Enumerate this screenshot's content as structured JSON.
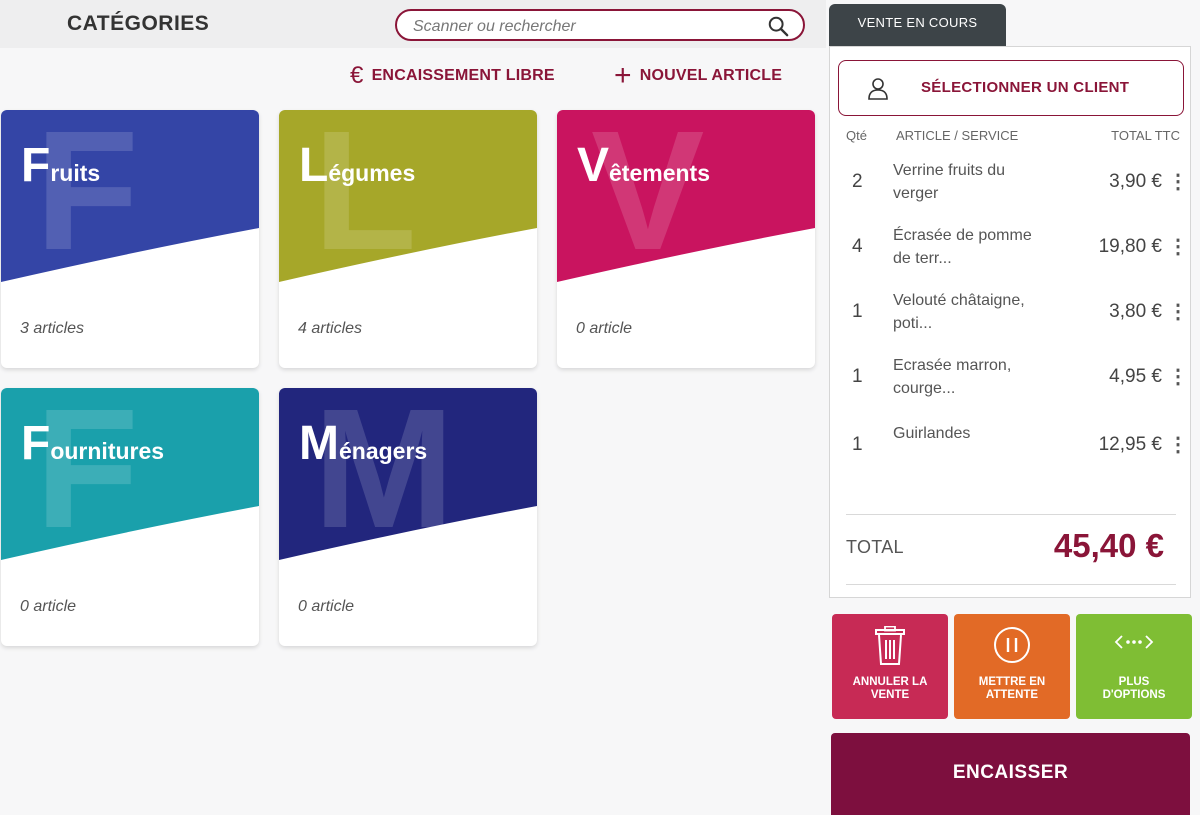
{
  "header": {
    "title": "CATÉGORIES",
    "search_placeholder": "Scanner ou rechercher"
  },
  "actions": {
    "free_checkout": "ENCAISSEMENT LIBRE",
    "free_checkout_glyph": "€",
    "new_item": "NOUVEL ARTICLE",
    "new_item_glyph": "+"
  },
  "categories": [
    {
      "initial": "F",
      "rest": "ruits",
      "count": "3 articles",
      "color": "#3445a6"
    },
    {
      "initial": "L",
      "rest": "égumes",
      "count": "4 articles",
      "color": "#a6a729"
    },
    {
      "initial": "V",
      "rest": "êtements",
      "count": "0 article",
      "color": "#c9145f"
    },
    {
      "initial": "F",
      "rest": "ournitures",
      "count": "0 article",
      "color": "#1aa0ab"
    },
    {
      "initial": "M",
      "rest": "énagers",
      "count": "0 article",
      "color": "#22267d"
    }
  ],
  "sale": {
    "tab_label": "VENTE EN COURS",
    "client_button": "SÉLECTIONNER UN CLIENT",
    "columns": {
      "qty": "Qté",
      "item": "ARTICLE / SERVICE",
      "total": "TOTAL TTC"
    },
    "lines": [
      {
        "qty": "2",
        "desc": "Verrine fruits du verger",
        "total": "3,90 €"
      },
      {
        "qty": "4",
        "desc": "Écrasée de pomme de terr...",
        "total": "19,80 €"
      },
      {
        "qty": "1",
        "desc": "Velouté châtaigne, poti...",
        "total": "3,80 €"
      },
      {
        "qty": "1",
        "desc": "Ecrasée marron, courge...",
        "total": "4,95 €"
      },
      {
        "qty": "1",
        "desc": "Guirlandes",
        "total": "12,95 €"
      }
    ],
    "more_glyph": "⋮",
    "total_label": "TOTAL",
    "total_value": "45,40 €"
  },
  "buttons": {
    "cancel": "ANNULER LA VENTE",
    "hold": "METTRE EN ATTENTE",
    "more": "PLUS D'OPTIONS",
    "pay": "ENCAISSER"
  },
  "colors": {
    "brand": "#8a1538",
    "cancel": "#c72a55",
    "hold": "#e26a26",
    "more": "#7fbe34",
    "pay": "#7d0f3e",
    "tab": "#3d4448"
  }
}
